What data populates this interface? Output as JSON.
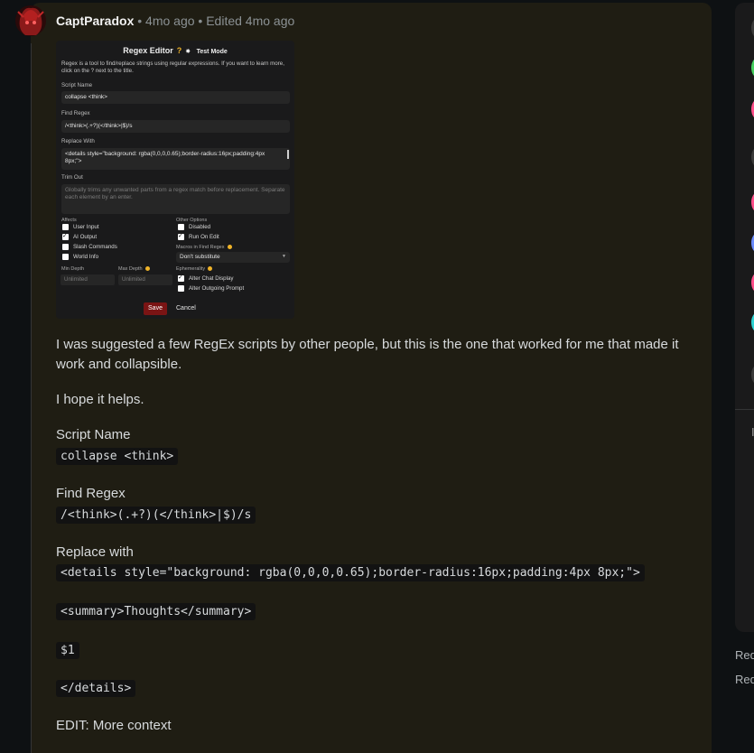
{
  "comment": {
    "author": "CaptParadox",
    "separator": " • ",
    "posted": "4mo ago",
    "edited": "Edited 4mo ago",
    "paragraphs": [
      "I was suggested a few RegEx scripts by other people, but this is the one that worked for me that made it work and collapsible.",
      "I hope it helps."
    ],
    "script_name_label": "Script Name",
    "script_name_value": "collapse <think>",
    "find_regex_label": "Find Regex",
    "find_regex_value": "/<think>(.+?)(</think>|$)/s",
    "replace_label": "Replace with",
    "replace_lines": [
      "<details style=\"background: rgba(0,0,0,0.65);border-radius:16px;padding:4px 8px;\">",
      "<summary>Thoughts</summary>",
      "$1",
      "</details>"
    ],
    "edit_note": "EDIT: More context"
  },
  "embed": {
    "title": "Regex Editor",
    "help_mark": "?",
    "test_mode": "Test Mode",
    "description": "Regex is a tool to find/replace strings using regular expressions. If you want to learn more, click on the ? next to the title.",
    "script_name_label": "Script Name",
    "script_name_value": "collapse <think>",
    "find_regex_label": "Find Regex",
    "find_regex_value": "/<think>(.+?)(</think>|$)/s",
    "replace_with_label": "Replace With",
    "replace_with_value": "<details style=\"background: rgba(0,0,0,0.65);border-radius:16px;padding:4px 8px;\">",
    "trim_out_label": "Trim Out",
    "trim_out_placeholder": "Globally trims any unwanted parts from a regex match before replacement. Separate each element by an enter.",
    "affects_label": "Affects",
    "affects": [
      {
        "label": "User Input",
        "checked": false
      },
      {
        "label": "AI Output",
        "checked": true
      },
      {
        "label": "Slash Commands",
        "checked": false
      },
      {
        "label": "World Info",
        "checked": false
      }
    ],
    "other_options_label": "Other Options",
    "other_options": [
      {
        "label": "Disabled",
        "checked": false
      },
      {
        "label": "Run On Edit",
        "checked": true
      }
    ],
    "macros_label": "Macros in Find Regex",
    "macros_value": "Don't substitute",
    "min_depth_label": "Min Depth",
    "max_depth_label": "Max Depth",
    "min_depth_placeholder": "Unlimited",
    "max_depth_placeholder": "Unlimited",
    "ephemerality_label": "Ephemerality",
    "ephemerality": [
      {
        "label": "Alter Chat Display",
        "checked": true
      },
      {
        "label": "Alter Outgoing Prompt",
        "checked": false
      }
    ],
    "save_label": "Save",
    "cancel_label": "Cancel"
  },
  "sidebar": {
    "dot_colors": [
      "#3a3a3a",
      "#46d160",
      "#ff4f8b",
      "#3a3a3a",
      "#ff4f8b",
      "#6b8cff",
      "#ff4f8b",
      "#2ed3d3",
      "#3a3a3a"
    ],
    "letter": "I",
    "footer_links": [
      "Red",
      "Red"
    ]
  }
}
